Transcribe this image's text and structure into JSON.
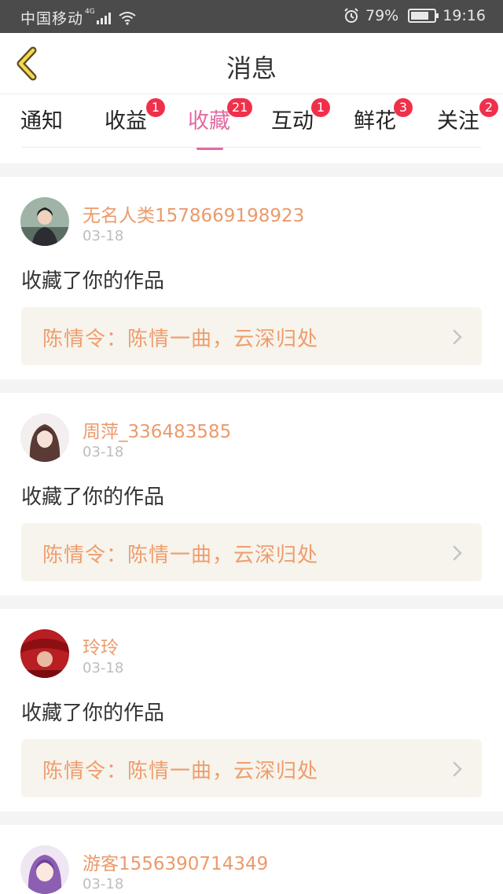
{
  "status_bar": {
    "carrier": "中国移动",
    "network": "4G",
    "battery": "79%",
    "battery_level": 0.79,
    "time": "19:16"
  },
  "nav": {
    "title": "消息"
  },
  "tabs": [
    {
      "label": "通知",
      "badge": ""
    },
    {
      "label": "收益",
      "badge": "1"
    },
    {
      "label": "收藏",
      "badge": "21",
      "active": true
    },
    {
      "label": "互动",
      "badge": "1"
    },
    {
      "label": "鲜花",
      "badge": "3"
    },
    {
      "label": "关注",
      "badge": "2"
    }
  ],
  "feed": [
    {
      "username": "无名人类1578669198923",
      "date": "03-18",
      "action": "收藏了你的作品",
      "work_title": "陈情令：陈情一曲，云深归处"
    },
    {
      "username": "周萍_336483585",
      "date": "03-18",
      "action": "收藏了你的作品",
      "work_title": "陈情令：陈情一曲，云深归处"
    },
    {
      "username": "玲玲",
      "date": "03-18",
      "action": "收藏了你的作品",
      "work_title": "陈情令：陈情一曲，云深归处"
    },
    {
      "username": "游客1556390714349",
      "date": "03-18",
      "action": "",
      "work_title": ""
    }
  ],
  "colors": {
    "accent_pink": "#e26aa3",
    "badge_red": "#f0304a",
    "username_orange": "#eb9a6b",
    "work_bg": "#f6f4ec"
  }
}
